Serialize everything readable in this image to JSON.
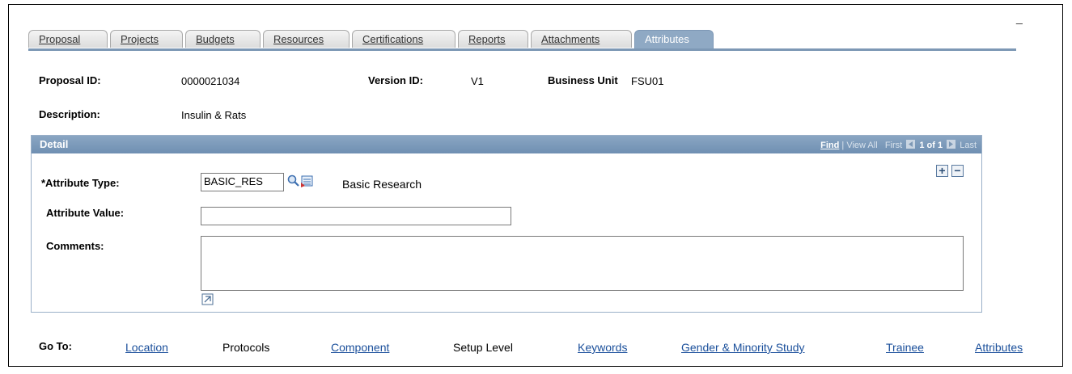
{
  "window": {
    "minimize_label": "_"
  },
  "tabs": [
    {
      "label": "Proposal",
      "active": false
    },
    {
      "label": "Projects",
      "active": false
    },
    {
      "label": "Budgets",
      "active": false
    },
    {
      "label": "Resources",
      "active": false
    },
    {
      "label": "Certifications",
      "active": false
    },
    {
      "label": "Reports",
      "active": false
    },
    {
      "label": "Attachments",
      "active": false
    },
    {
      "label": "Attributes",
      "active": true
    }
  ],
  "header": {
    "proposal_id_label": "Proposal ID:",
    "proposal_id_value": "0000021034",
    "version_id_label": "Version ID:",
    "version_id_value": "V1",
    "business_unit_label": "Business Unit",
    "business_unit_value": "FSU01",
    "description_label": "Description:",
    "description_value": "Insulin & Rats"
  },
  "detail": {
    "title": "Detail",
    "nav": {
      "find": "Find",
      "view_all": "View All",
      "first": "First",
      "count": "1 of 1",
      "last": "Last"
    },
    "attribute_type_label": "*Attribute Type:",
    "attribute_type_value": "BASIC_RES",
    "attribute_type_description": "Basic Research",
    "attribute_value_label": "Attribute Value:",
    "attribute_value_value": "",
    "comments_label": "Comments:",
    "comments_value": "",
    "add_row_label": "+",
    "delete_row_label": "−"
  },
  "goto": {
    "label": "Go To:",
    "items": [
      {
        "label": "Location",
        "link": true
      },
      {
        "label": "Protocols",
        "link": false
      },
      {
        "label": "Component",
        "link": true
      },
      {
        "label": "Setup Level",
        "link": false
      },
      {
        "label": "Keywords",
        "link": true
      },
      {
        "label": "Gender & Minority Study",
        "link": true
      },
      {
        "label": "Trainee",
        "link": true
      },
      {
        "label": "Attributes",
        "link": true
      }
    ]
  },
  "colors": {
    "tab_active": "#8fa9c4",
    "detail_header": "#7d98b5",
    "link": "#1a4f9b"
  }
}
